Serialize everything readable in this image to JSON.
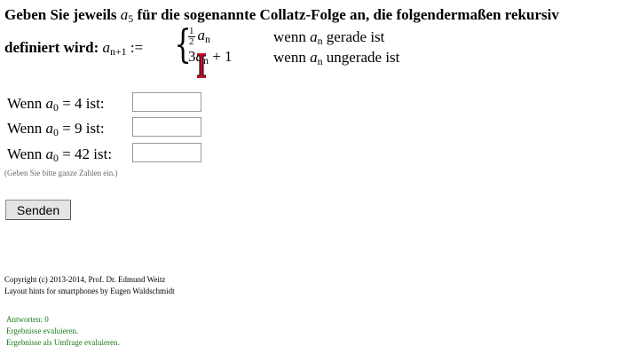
{
  "task": {
    "intro_before": "Geben Sie jeweils",
    "intro_var": "a",
    "intro_var_sub": "5",
    "intro_after": "für die sogenannte Collatz-Folge an, die folgendermaßen rekursiv",
    "def_prefix": "definiert wird:",
    "def_lhs_var": "a",
    "def_lhs_sub": "n+1",
    "def_assign": ":=",
    "case1_frac_num": "1",
    "case1_frac_den": "2",
    "case1_var": "a",
    "case1_sub": "n",
    "case1_cond_pre": "wenn",
    "case1_cond_var": "a",
    "case1_cond_sub": "n",
    "case1_cond_post": "gerade ist",
    "case2_coef": "3",
    "case2_var": "a",
    "case2_sub": "n",
    "case2_tail": "+ 1",
    "case2_cond_pre": "wenn",
    "case2_cond_var": "a",
    "case2_cond_sub": "n",
    "case2_cond_post": "ungerade ist"
  },
  "questions": [
    {
      "label_pre": "Wenn",
      "var": "a",
      "sub": "0",
      "label_post": "= 4 ist:",
      "value": ""
    },
    {
      "label_pre": "Wenn",
      "var": "a",
      "sub": "0",
      "label_post": "= 9 ist:",
      "value": ""
    },
    {
      "label_pre": "Wenn",
      "var": "a",
      "sub": "0",
      "label_post": "= 42 ist:",
      "value": ""
    }
  ],
  "hint": "(Geben Sie bitte ganze Zahlen ein.)",
  "submit_label": "Senden",
  "footer": {
    "copyright": "Copyright (c) 2013-2014, Prof. Dr. Edmund Weitz",
    "layout_hints": "Layout hints for smartphones by Eugen Waldschmidt"
  },
  "links": {
    "answers": "Antworten: 0",
    "evaluate": "Ergebnisse evaluieren.",
    "survey": "Ergebnisse als Umfrage evaluieren."
  },
  "colors": {
    "link_green": "#1a7a1a",
    "cursor_red": "#c8102e"
  },
  "icons": {
    "cursor": "i-beam-cursor-icon"
  }
}
